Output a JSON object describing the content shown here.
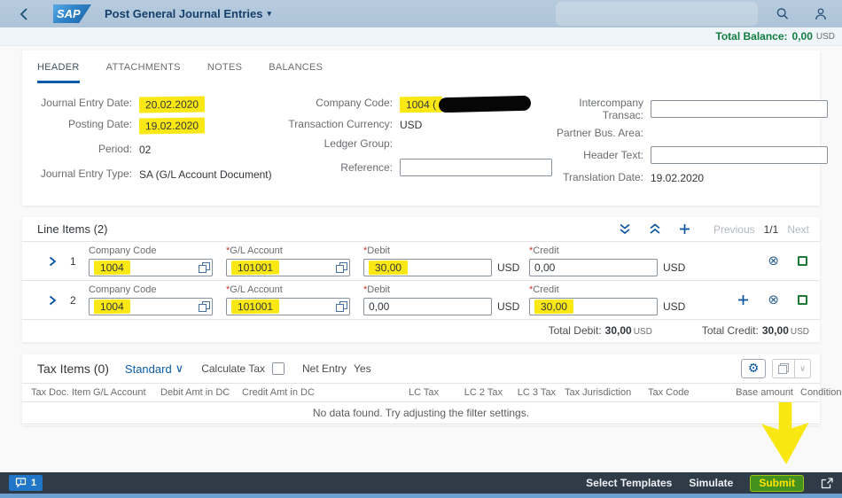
{
  "shell": {
    "logo_text": "SAP",
    "title": "Post General Journal Entries"
  },
  "balance_bar": {
    "label": "Total Balance:",
    "value": "0,00",
    "currency": "USD"
  },
  "tabs": {
    "header": "HEADER",
    "attachments": "ATTACHMENTS",
    "notes": "NOTES",
    "balances": "BALANCES"
  },
  "header_form": {
    "journal_entry_date": {
      "label": "Journal Entry Date:",
      "value": "20.02.2020"
    },
    "posting_date": {
      "label": "Posting Date:",
      "value": "19.02.2020"
    },
    "period": {
      "label": "Period:",
      "value": "02"
    },
    "journal_entry_type": {
      "label": "Journal Entry Type:",
      "value": "SA (G/L Account Document)"
    },
    "company_code": {
      "label": "Company Code:",
      "value": "1004 ("
    },
    "transaction_currency": {
      "label": "Transaction Currency:",
      "value": "USD"
    },
    "ledger_group": {
      "label": "Ledger Group:",
      "value": ""
    },
    "reference": {
      "label": "Reference:"
    },
    "intercompany_transac": {
      "label": "Intercompany Transac:"
    },
    "partner_bus_area": {
      "label": "Partner Bus. Area:",
      "value": ""
    },
    "header_text": {
      "label": "Header Text:"
    },
    "translation_date": {
      "label": "Translation Date:",
      "value": "19.02.2020"
    }
  },
  "line_items": {
    "title": "Line Items (2)",
    "pager": {
      "previous": "Previous",
      "page": "1/1",
      "next": "Next"
    },
    "required_marker": "*",
    "columns": {
      "company_code": "Company Code",
      "gl_account": "G/L Account",
      "debit": "Debit",
      "credit": "Credit"
    },
    "currency": "USD",
    "rows": [
      {
        "num": "1",
        "company_code": "1004",
        "gl_account": "101001",
        "debit": "30,00",
        "credit": "0,00"
      },
      {
        "num": "2",
        "company_code": "1004",
        "gl_account": "101001",
        "debit": "0,00",
        "credit": "30,00"
      }
    ],
    "totals": {
      "debit_label": "Total Debit:",
      "debit_value": "30,00",
      "credit_label": "Total Credit:",
      "credit_value": "30,00",
      "currency": "USD"
    }
  },
  "tax_items": {
    "title": "Tax Items (0)",
    "variant": "Standard",
    "calculate_tax_label": "Calculate Tax",
    "net_entry_label": "Net Entry",
    "net_entry_value": "Yes",
    "columns": [
      "Tax Doc. Item",
      "G/L Account",
      "Debit Amt in DC",
      "Credit Amt in DC",
      "LC Tax",
      "LC 2 Tax",
      "LC 3 Tax",
      "Tax Jurisdiction",
      "Tax Code",
      "Base amount",
      "Condition Type"
    ],
    "no_data": "No data found. Try adjusting the filter settings."
  },
  "footer": {
    "messages_count": "1",
    "select_templates": "Select Templates",
    "simulate": "Simulate",
    "submit": "Submit"
  },
  "icons": {
    "gear": "⚙",
    "remove": "⊗",
    "caret_down": "▾",
    "chevron_down": "∨"
  },
  "colors": {
    "accent_blue": "#0854a0",
    "positive_green": "#107e3e",
    "highlight_yellow": "#fae815",
    "submit_green": "#44911e"
  }
}
